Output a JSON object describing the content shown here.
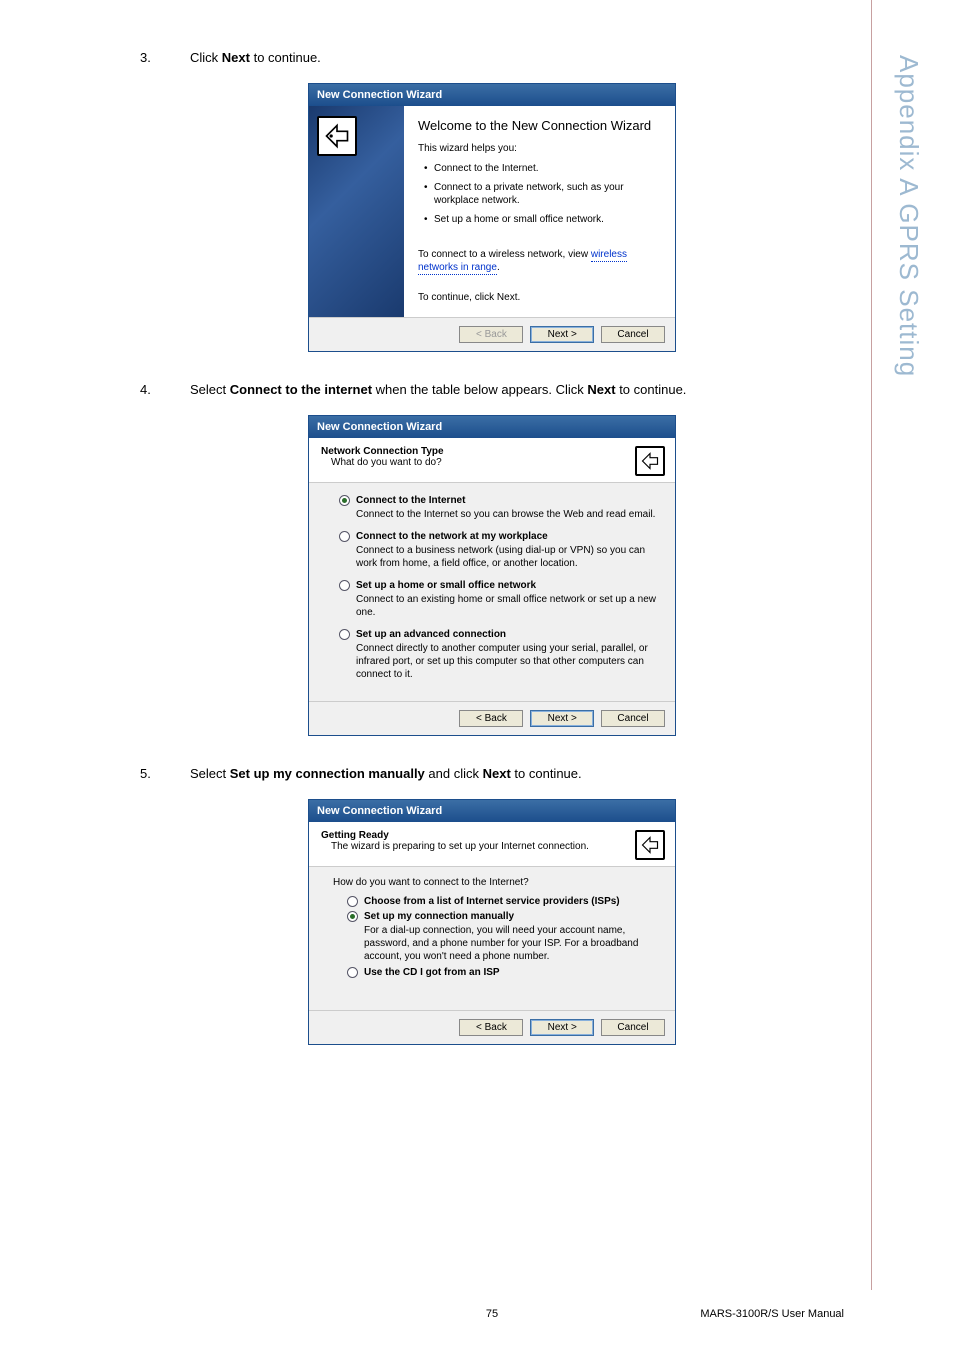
{
  "sidebar": "Appendix A   GPRS Setting",
  "steps": {
    "s3": {
      "num": "3.",
      "pre": "Click ",
      "bold": "Next",
      "post": " to continue."
    },
    "s4": {
      "num": "4.",
      "pre": "Select ",
      "bold": "Connect to the internet",
      "mid": " when the table below appears. Click ",
      "bold2": "Next",
      "post": " to continue."
    },
    "s5": {
      "num": "5.",
      "pre": "Select ",
      "bold": "Set up my connection manually",
      "mid": " and click ",
      "bold2": "Next",
      "post": " to continue."
    }
  },
  "dialog1": {
    "title": "New Connection Wizard",
    "welcome": "Welcome to the New Connection Wizard",
    "helps": "This wizard helps you:",
    "b1": "Connect to the Internet.",
    "b2": "Connect to a private network, such as your workplace network.",
    "b3": "Set up a home or small office network.",
    "wireless_pre": "To connect to a wireless network, view ",
    "wireless_link": "wireless networks in range",
    "wireless_post": ".",
    "continue": "To continue, click Next.",
    "back": "< Back",
    "next": "Next >",
    "cancel": "Cancel"
  },
  "dialog2": {
    "title": "New Connection Wizard",
    "header_title": "Network Connection Type",
    "header_sub": "What do you want to do?",
    "options": [
      {
        "label": "Connect to the Internet",
        "desc": "Connect to the Internet so you can browse the Web and read email.",
        "selected": true
      },
      {
        "label": "Connect to the network at my workplace",
        "desc": "Connect to a business network (using dial-up or VPN) so you can work from home, a field office, or another location.",
        "selected": false
      },
      {
        "label": "Set up a home or small office network",
        "desc": "Connect to an existing home or small office network or set up a new one.",
        "selected": false
      },
      {
        "label": "Set up an advanced connection",
        "desc": "Connect directly to another computer using your serial, parallel, or infrared port, or set up this computer so that other computers can connect to it.",
        "selected": false
      }
    ],
    "back": "< Back",
    "next": "Next >",
    "cancel": "Cancel"
  },
  "dialog3": {
    "title": "New Connection Wizard",
    "header_title": "Getting Ready",
    "header_sub": "The wizard is preparing to set up your Internet connection.",
    "prompt": "How do you want to connect to the Internet?",
    "options": [
      {
        "label": "Choose from a list of Internet service providers (ISPs)",
        "desc": "",
        "selected": false
      },
      {
        "label": "Set up my connection manually",
        "desc": "For a dial-up connection, you will need your account name, password, and a phone number for your ISP. For a broadband account, you won't need a phone number.",
        "selected": true
      },
      {
        "label": "Use the CD I got from an ISP",
        "desc": "",
        "selected": false
      }
    ],
    "back": "< Back",
    "next": "Next >",
    "cancel": "Cancel"
  },
  "footer": {
    "page": "75",
    "manual": "MARS-3100R/S User Manual"
  }
}
